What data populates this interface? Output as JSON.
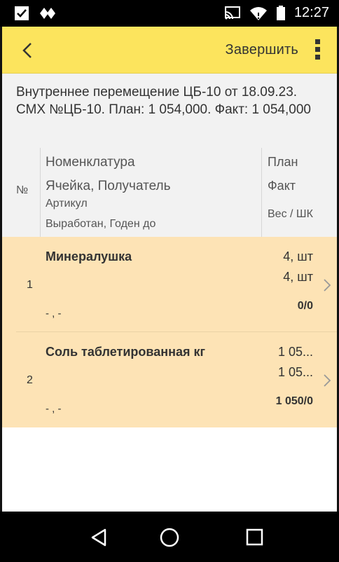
{
  "status_bar": {
    "time": "12:27"
  },
  "toolbar": {
    "finish_label": "Завершить"
  },
  "document": {
    "title": "Внутреннее перемещение ЦБ-10 от 18.09.23. СМХ №ЦБ-10. План: 1 054,000. Факт: 1 054,000"
  },
  "table_header": {
    "num": "№",
    "col_nomenclature": "Номенклатура",
    "col_cell": "Ячейка, Получатель",
    "col_article": "Артикул",
    "col_produced": "Выработан, Годен до",
    "col_plan": "План",
    "col_fact": "Факт",
    "col_weight": "Вес / ШК"
  },
  "rows": [
    {
      "num": "1",
      "name": "Минералушка",
      "plan": "4, шт",
      "fact": "4, шт",
      "weight": "0/0",
      "extra": "- , -"
    },
    {
      "num": "2",
      "name": "Соль таблетированная кг",
      "plan": "1 05...",
      "fact": "1 05...",
      "weight": "1 050/0",
      "extra": "- , -"
    }
  ]
}
